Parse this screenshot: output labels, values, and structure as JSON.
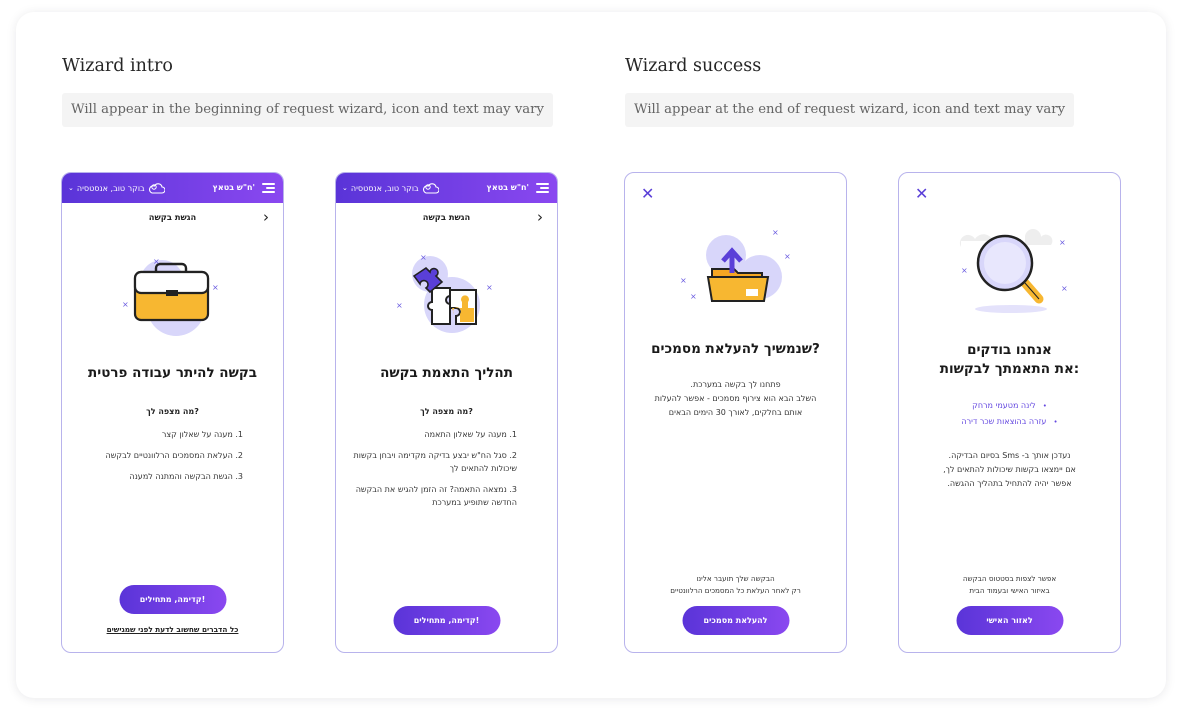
{
  "intro": {
    "title": "Wizard intro",
    "description": "Will appear in the beginning of request wizard, icon and text may vary"
  },
  "success": {
    "title": "Wizard success",
    "description": "Will appear at the end of request wizard, icon and text may vary"
  },
  "app_bar": {
    "greeting": "בוקר טוב, אנסטסיה",
    "brand": "ח\"ש בטאץ'",
    "accent_color": "#6a3de0"
  },
  "screen1": {
    "header": "הגשת בקשה",
    "title": "בקשה להיתר עבודה פרטית",
    "subtitle": "מה מצפה לך?",
    "steps": [
      "1. מענה על שאלון קצר",
      "2. העלאת המסמכים הרלוונטיים לבקשה",
      "3. הגשת הבקשה והמתנה למענה"
    ],
    "cta": "קדימה, מתחילים!",
    "link": "כל הדברים שחשוב לדעת לפני שמגישים",
    "icon": "briefcase-icon"
  },
  "screen2": {
    "header": "הגשת בקשה",
    "title": "תהליך התאמת בקשה",
    "subtitle": "מה מצפה לך?",
    "steps": [
      "1. מענה על שאלון התאמה",
      "2. סגל הח\"ש יבצע בדיקה מקדימה ויבחן בקשות שיכולות להתאים לך",
      "3. נמצאה התאמה? זה הזמן להגיש את הבקשה החדשה שתופיע במערכת"
    ],
    "cta": "קדימה, מתחילים!",
    "icon": "puzzle-icon"
  },
  "screen3": {
    "title": "שנמשיך להעלאת מסמכים?",
    "body": [
      "פתחנו לך בקשה במערכת.",
      "השלב הבא הוא צירוף מסמכים - אפשר להעלות",
      "אותם בחלקים, לאורך 30 הימים הבאים"
    ],
    "footnote": [
      "הבקשה שלך תועבר אלינו",
      "רק לאחר העלאת כל המסמכים הרלוונטיים"
    ],
    "cta": "להעלאת מסמכים",
    "icon": "folder-upload-icon"
  },
  "screen4": {
    "title_line1": "אנחנו בודקים",
    "title_line2": "את התאמתך לבקשות:",
    "bullets": [
      "לינה מטעמי מרחק",
      "עזרה בהוצאות שכר דירה"
    ],
    "body": [
      "נעדכן אותך ב- Sms בסיום הבדיקה.",
      "אם יימצאו בקשות שיכולות להתאים לך,",
      "אפשר יהיה להתחיל בתהליך ההגשה."
    ],
    "footnote": [
      "אפשר לצפות בסטטוס הבקשה",
      "באיזור האישי ובעמוד הבית"
    ],
    "cta": "לאזור האישי",
    "icon": "magnifier-icon"
  }
}
